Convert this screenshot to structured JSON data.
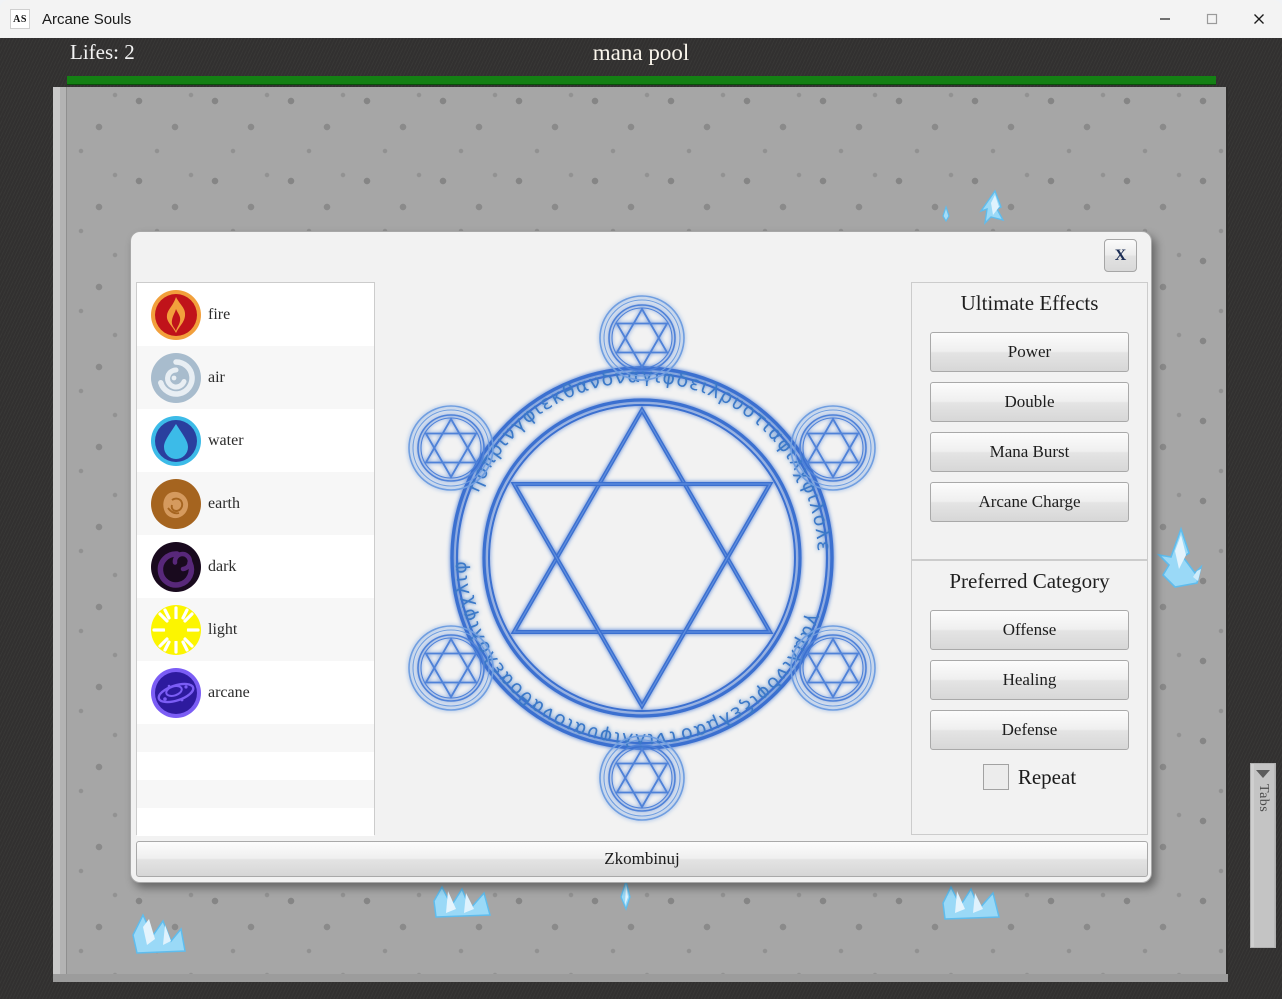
{
  "window": {
    "title": "Arcane Souls",
    "icon_text": "AS",
    "controls": {
      "minimize": "minimize-icon",
      "maximize": "maximize-icon",
      "close": "close-icon"
    }
  },
  "hud": {
    "lifes_text": "Lifes: 2",
    "stage_title": "mana pool",
    "mana_bar_color": "#148014",
    "mana_bar_percent": 100
  },
  "playfield": {
    "tabs_label": "Tabs",
    "tabs_arrow": "chevron-down-icon",
    "floor_color": "#a6a6a6",
    "crystal_color": "#7ecbf5"
  },
  "dialog": {
    "close_label": "X",
    "combine_label": "Zkombinuj",
    "elements": [
      {
        "name": "fire",
        "icon": "fire-icon",
        "color": "#c0131a",
        "accent": "#f2a03c"
      },
      {
        "name": "air",
        "icon": "air-icon",
        "color": "#a8bccd",
        "accent": "#e8eef3"
      },
      {
        "name": "water",
        "icon": "water-icon",
        "color": "#2a3f9e",
        "accent": "#3cbbe8"
      },
      {
        "name": "earth",
        "icon": "earth-icon",
        "color": "#a5641f",
        "accent": "#d59a5e"
      },
      {
        "name": "dark",
        "icon": "dark-icon",
        "color": "#190a1e",
        "accent": "#58287a"
      },
      {
        "name": "light",
        "icon": "light-icon",
        "color": "#fcf500",
        "accent": "#ffffff"
      },
      {
        "name": "arcane",
        "icon": "arcane-icon",
        "color": "#2d1a9e",
        "accent": "#7b5df5"
      }
    ],
    "empty_row_count": 4,
    "ultimate_effects": {
      "title": "Ultimate Effects",
      "buttons": [
        "Power",
        "Double",
        "Mana Burst",
        "Arcane Charge"
      ]
    },
    "preferred_category": {
      "title": "Preferred Category",
      "buttons": [
        "Offense",
        "Healing",
        "Defense"
      ],
      "repeat_label": "Repeat",
      "repeat_checked": false
    },
    "magic_circle": {
      "stroke_color": "#3a6fd0",
      "glyph_text": "ηοπρινγφιεκθανδναγιφδειλρυοτιαφιλχφιλολεαοθανοιαυφιλλιντοαμλεξιφδνιλμαγ",
      "node_count": 6,
      "node_symbol": "hexagram"
    }
  }
}
